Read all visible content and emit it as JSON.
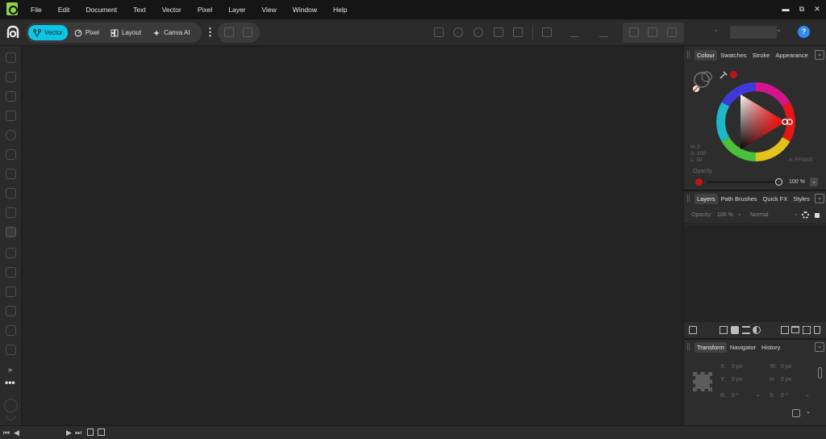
{
  "menu": [
    "File",
    "Edit",
    "Document",
    "Text",
    "Vector",
    "Pixel",
    "Layer",
    "View",
    "Window",
    "Help"
  ],
  "window_controls": {
    "minimize": "▬",
    "restore": "⧉",
    "close": "✕"
  },
  "toolbar": {
    "personas": [
      {
        "label": "Vector",
        "icon": "vector-persona-icon",
        "active": true
      },
      {
        "label": "Pixel",
        "icon": "pixel-persona-icon",
        "active": false
      },
      {
        "label": "Layout",
        "icon": "layout-persona-icon",
        "active": false
      },
      {
        "label": "Canva AI",
        "icon": "sparkle-icon",
        "active": false
      }
    ],
    "more": "⋮",
    "help": "?",
    "zoom_chevron": "⌄"
  },
  "tools": {
    "expand": "»",
    "more": "•••"
  },
  "status": {
    "first": "⏮",
    "prev": "◀",
    "next": "▶",
    "last": "⏭"
  },
  "colour_panel": {
    "tabs": [
      "Colour",
      "Swatches",
      "Stroke",
      "Appearance"
    ],
    "hsl": [
      "H: 0",
      "S: 100",
      "L: 50"
    ],
    "hex": "#: FF0000",
    "opacity_label": "Opacity",
    "opacity_value": "100 %",
    "accent": "#ff0000"
  },
  "layers_panel": {
    "tabs": [
      "Layers",
      "Path Brushes",
      "Quick FX",
      "Styles"
    ],
    "opacity_label": "Opacity:",
    "opacity_value": "100 %",
    "blend_mode": "Normal"
  },
  "transform_panel": {
    "tabs": [
      "Transform",
      "Navigator",
      "History"
    ],
    "fields": [
      {
        "label": "X:",
        "value": "0 px"
      },
      {
        "label": "W:",
        "value": "0 px"
      },
      {
        "label": "Y:",
        "value": "0 px"
      },
      {
        "label": "H:",
        "value": "0 px"
      },
      {
        "label": "R:",
        "value": "0 °"
      },
      {
        "label": "S:",
        "value": "0 °"
      }
    ]
  }
}
